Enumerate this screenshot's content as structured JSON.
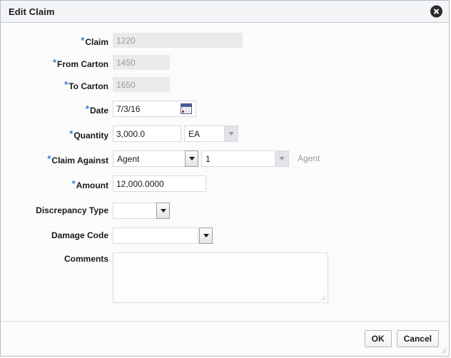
{
  "dialog": {
    "title": "Edit Claim",
    "close_icon": "close-circle-icon"
  },
  "form": {
    "claim": {
      "label": "Claim",
      "required_marker": "*",
      "value": "1220",
      "disabled": true
    },
    "from_carton": {
      "label": "From Carton",
      "required_marker": "*",
      "value": "1450",
      "disabled": true
    },
    "to_carton": {
      "label": "To Carton",
      "required_marker": "*",
      "value": "1650",
      "disabled": true
    },
    "date": {
      "label": "Date",
      "required_marker": "*",
      "value": "7/3/16",
      "icon": "calendar-icon"
    },
    "quantity": {
      "label": "Quantity",
      "required_marker": "*",
      "value": "3,000.0",
      "uom_value": "EA",
      "uom_options": [
        "EA"
      ]
    },
    "claim_against": {
      "label": "Claim Against",
      "required_marker": "*",
      "value": "Agent",
      "options": [
        "Agent"
      ],
      "sequence_value": "1",
      "sequence_options": [
        "1"
      ],
      "trailing_text": "Agent"
    },
    "amount": {
      "label": "Amount",
      "required_marker": "*",
      "value": "12,000.0000"
    },
    "discrepancy_type": {
      "label": "Discrepancy Type",
      "value": "",
      "options": []
    },
    "damage_code": {
      "label": "Damage Code",
      "value": "",
      "options": []
    },
    "comments": {
      "label": "Comments",
      "value": "",
      "placeholder": ""
    }
  },
  "footer": {
    "ok_label": "OK",
    "cancel_label": "Cancel"
  },
  "colors": {
    "required_asterisk": "#3a7bd5",
    "titlebar_bg": "#f3f4f6",
    "dialog_border": "#b5bdc9",
    "disabled_field_bg": "#e9eaec",
    "disabled_text": "#9a9a9a"
  }
}
